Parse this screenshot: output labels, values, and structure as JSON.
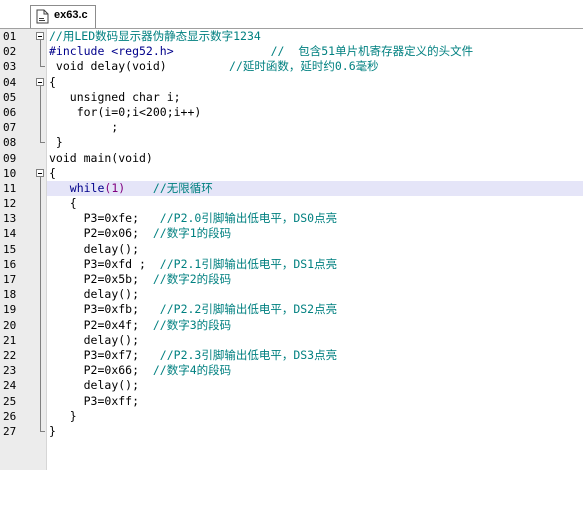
{
  "tab": {
    "title": "ex63.c"
  },
  "code": {
    "line_numbers": [
      "01",
      "02",
      "03",
      "04",
      "05",
      "06",
      "07",
      "08",
      "09",
      "10",
      "11",
      "12",
      "13",
      "14",
      "15",
      "16",
      "17",
      "18",
      "19",
      "20",
      "21",
      "22",
      "23",
      "24",
      "25",
      "26",
      "27"
    ],
    "l01_comment": "//用LED数码显示器伪静态显示数字1234",
    "l02_directive": "#include <reg52.h>",
    "l02_comment": "//  包含51单片机寄存器定义的头文件",
    "l03_decl": " void delay(void)",
    "l03_comment": "//延时函数，延时约0.6毫秒",
    "l04": "{",
    "l05": "   unsigned char i;",
    "l06": "    for(i=0;i<200;i++)",
    "l07": "         ;",
    "l08": " }",
    "l09": "void main(void)",
    "l10": "{",
    "l11_kw": "while",
    "l11_cond": "(1)",
    "l11_comment": "//无限循环",
    "l12": "   {",
    "l13_code": "P3=0xfe;",
    "l13_comment": "//P2.0引脚输出低电平，DS0点亮",
    "l14_code": "P2=0x06;",
    "l14_comment": "//数字1的段码",
    "l15": "delay();",
    "l16_code": "P3=0xfd ;",
    "l16_comment": "//P2.1引脚输出低电平，DS1点亮",
    "l17_code": "P2=0x5b;",
    "l17_comment": "//数字2的段码",
    "l18": "delay();",
    "l19_code": "P3=0xfb;",
    "l19_comment": "//P2.2引脚输出低电平，DS2点亮",
    "l20_code": "P2=0x4f;",
    "l20_comment": "//数字3的段码",
    "l21": "delay();",
    "l22_code": "P3=0xf7;",
    "l22_comment": "//P2.3引脚输出低电平，DS3点亮",
    "l23_code": "P2=0x66;",
    "l23_comment": "//数字4的段码",
    "l24": "delay();",
    "l25": "P3=0xff;",
    "l26": "   }",
    "l27": "}"
  },
  "colors": {
    "comment": "#008080",
    "keyword": "#00008b",
    "constant": "#800080",
    "current_line_bg": "#e5e5f8",
    "gutter_bg": "#ececec"
  },
  "icons": {
    "tab": "c-source-file-icon",
    "fold": "fold-collapse-icon"
  }
}
